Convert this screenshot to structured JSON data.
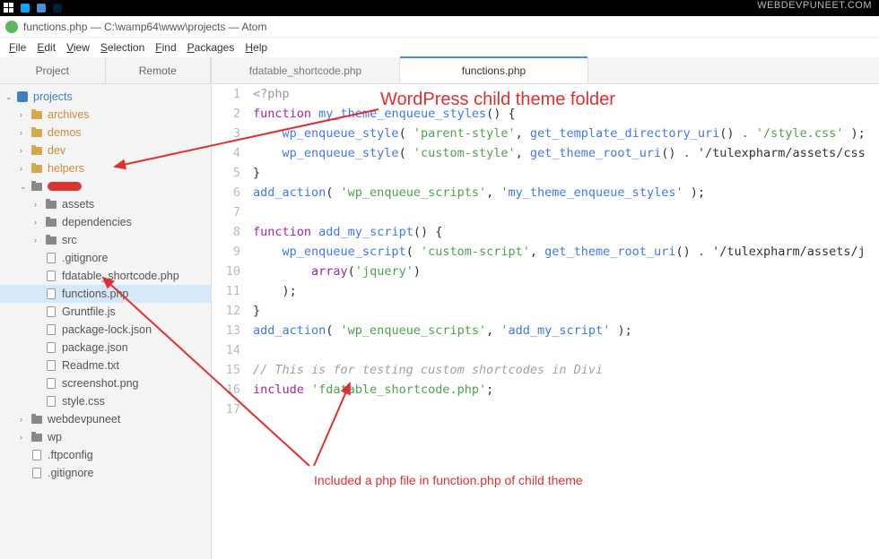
{
  "watermark": "WEBDEVPUNEET.COM",
  "title": "functions.php — C:\\wamp64\\www\\projects — Atom",
  "menubar": [
    "File",
    "Edit",
    "View",
    "Selection",
    "Find",
    "Packages",
    "Help"
  ],
  "sidebar_tabs": {
    "project": "Project",
    "remote": "Remote"
  },
  "tree": {
    "root": "projects",
    "items": [
      {
        "label": "archives",
        "type": "folder-open",
        "indent": 1,
        "chev": "›"
      },
      {
        "label": "demos",
        "type": "folder-open",
        "indent": 1,
        "chev": "›"
      },
      {
        "label": "dev",
        "type": "folder-open",
        "indent": 1,
        "chev": "›"
      },
      {
        "label": "helpers",
        "type": "folder-open",
        "indent": 1,
        "chev": "›"
      },
      {
        "label": "",
        "type": "redacted",
        "indent": 1,
        "chev": "⌄"
      },
      {
        "label": "assets",
        "type": "folder-closed",
        "indent": 2,
        "chev": "›"
      },
      {
        "label": "dependencies",
        "type": "folder-closed",
        "indent": 2,
        "chev": "›"
      },
      {
        "label": "src",
        "type": "folder-closed",
        "indent": 2,
        "chev": "›"
      },
      {
        "label": ".gitignore",
        "type": "file",
        "indent": 2
      },
      {
        "label": "fdatable_shortcode.php",
        "type": "file",
        "indent": 2
      },
      {
        "label": "functions.php",
        "type": "file",
        "indent": 2,
        "selected": true
      },
      {
        "label": "Gruntfile.js",
        "type": "file",
        "indent": 2
      },
      {
        "label": "package-lock.json",
        "type": "file",
        "indent": 2
      },
      {
        "label": "package.json",
        "type": "file",
        "indent": 2
      },
      {
        "label": "Readme.txt",
        "type": "file",
        "indent": 2
      },
      {
        "label": "screenshot.png",
        "type": "file",
        "indent": 2
      },
      {
        "label": "style.css",
        "type": "file",
        "indent": 2
      },
      {
        "label": "webdevpuneet",
        "type": "folder-closed",
        "indent": 1,
        "chev": "›"
      },
      {
        "label": "wp",
        "type": "folder-closed",
        "indent": 1,
        "chev": "›"
      },
      {
        "label": ".ftpconfig",
        "type": "file",
        "indent": 1
      },
      {
        "label": ".gitignore",
        "type": "file",
        "indent": 1
      }
    ]
  },
  "editor_tabs": [
    {
      "label": "fdatable_shortcode.php",
      "active": false
    },
    {
      "label": "functions.php",
      "active": true
    }
  ],
  "code_lines": [
    "<?php",
    "function my_theme_enqueue_styles() {",
    "    wp_enqueue_style( 'parent-style', get_template_directory_uri() . '/style.css' );",
    "    wp_enqueue_style( 'custom-style', get_theme_root_uri() . '/tulexpharm/assets/css",
    "}",
    "add_action( 'wp_enqueue_scripts', 'my_theme_enqueue_styles' );",
    "",
    "function add_my_script() {",
    "    wp_enqueue_script( 'custom-script', get_theme_root_uri() . '/tulexpharm/assets/j",
    "        array('jquery')",
    "    );",
    "}",
    "add_action( 'wp_enqueue_scripts', 'add_my_script' );",
    "",
    "// This is for testing custom shortcodes in Divi",
    "include 'fdatable_shortcode.php';",
    ""
  ],
  "annotations": {
    "title1": "WordPress child theme folder",
    "title2": "Included a php file in function.php of child theme"
  },
  "colors": {
    "annotation": "#e03030",
    "tab_active": "#4a90d9"
  }
}
